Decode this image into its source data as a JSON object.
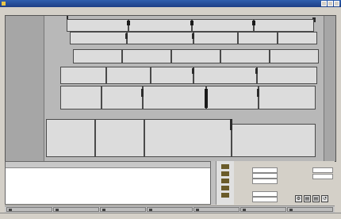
{
  "window": {
    "title": ""
  },
  "menu": [
    "",
    "",
    "",
    "",
    "",
    "",
    "",
    ""
  ],
  "table": {
    "columns": [
      "",
      ""
    ]
  },
  "properties": {
    "header": "",
    "rows": [
      "",
      "",
      "",
      "",
      "",
      ""
    ]
  },
  "options": {
    "header": "",
    "rows": [
      "",
      ""
    ]
  },
  "tabs": [
    "",
    "",
    "",
    "",
    "",
    "",
    ""
  ],
  "status": ""
}
